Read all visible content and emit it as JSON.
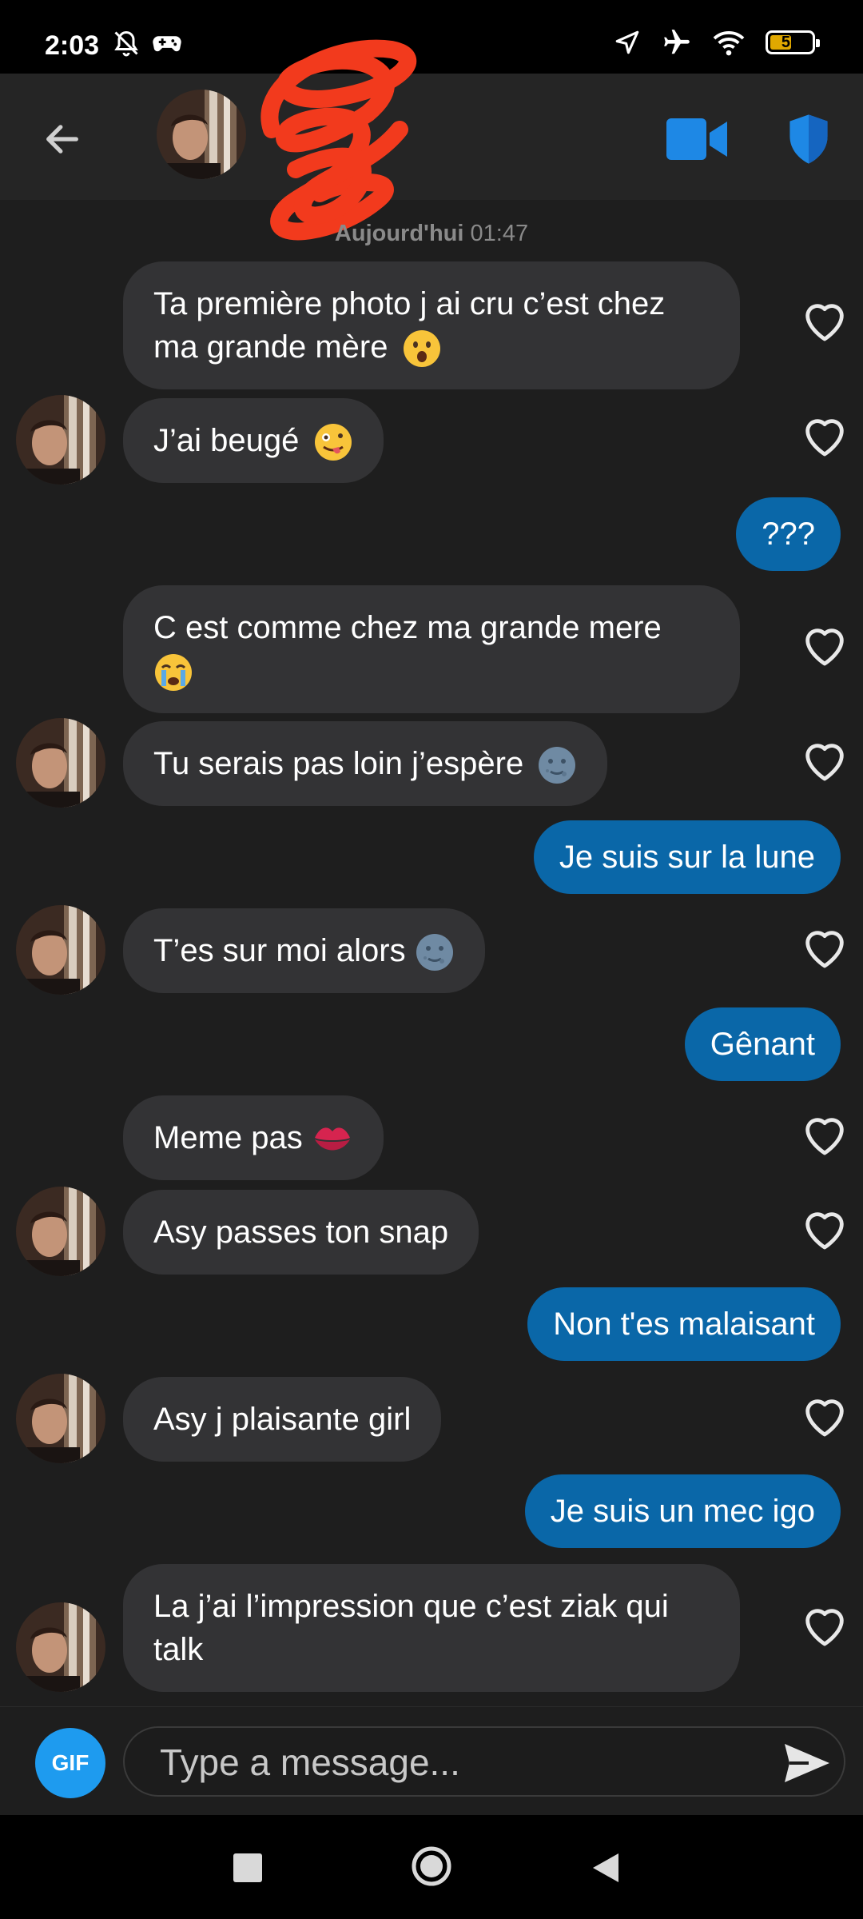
{
  "status_bar": {
    "time": "2:03",
    "battery_level": 51,
    "battery_label": "51",
    "icons": [
      "bell-off-icon",
      "game-controller-icon",
      "location-arrow-icon",
      "airplane-icon",
      "wifi-icon",
      "battery-icon"
    ]
  },
  "header": {
    "icons": [
      "back-arrow-icon",
      "avatar",
      "video-camera-icon",
      "shield-icon"
    ],
    "accent_color": "#1e88e5"
  },
  "date_separator": {
    "day": "Aujourd'hui",
    "time": "01:47"
  },
  "messages": [
    {
      "direction": "in",
      "text": "Ta première photo j ai cru c’est chez ma grande mère",
      "emoji": "astonished-face",
      "avatar": false
    },
    {
      "direction": "in",
      "text": "J’ai beugé",
      "emoji": "zany-face",
      "avatar": true
    },
    {
      "direction": "out",
      "text": "???"
    },
    {
      "direction": "in",
      "text": "C est comme chez ma grande mere",
      "emoji": "crying-face",
      "avatar": false
    },
    {
      "direction": "in",
      "text": "Tu serais pas loin j’espère",
      "emoji": "new-moon-face",
      "avatar": true
    },
    {
      "direction": "out",
      "text": "Je suis sur la lune"
    },
    {
      "direction": "in",
      "text": "T’es sur moi alors",
      "emoji": "new-moon-face",
      "avatar": true
    },
    {
      "direction": "out",
      "text": "Gênant"
    },
    {
      "direction": "in",
      "text": "Meme pas",
      "emoji": "kiss-mark",
      "avatar": false
    },
    {
      "direction": "in",
      "text": "Asy passes ton snap",
      "avatar": true
    },
    {
      "direction": "out",
      "text": "Non t'es malaisant"
    },
    {
      "direction": "in",
      "text": "Asy j plaisante girl",
      "avatar": true
    },
    {
      "direction": "out",
      "text": "Je suis un mec igo"
    },
    {
      "direction": "in",
      "text": "La j’ai l’impression que c’est ziak qui talk",
      "avatar": true
    }
  ],
  "composer": {
    "gif_label": "GIF",
    "placeholder": "Type a message..."
  },
  "colors": {
    "background": "#1e1e1e",
    "incoming_bubble": "#333335",
    "outgoing_bubble": "#0a67a8",
    "gif_button": "#1e9bef"
  }
}
